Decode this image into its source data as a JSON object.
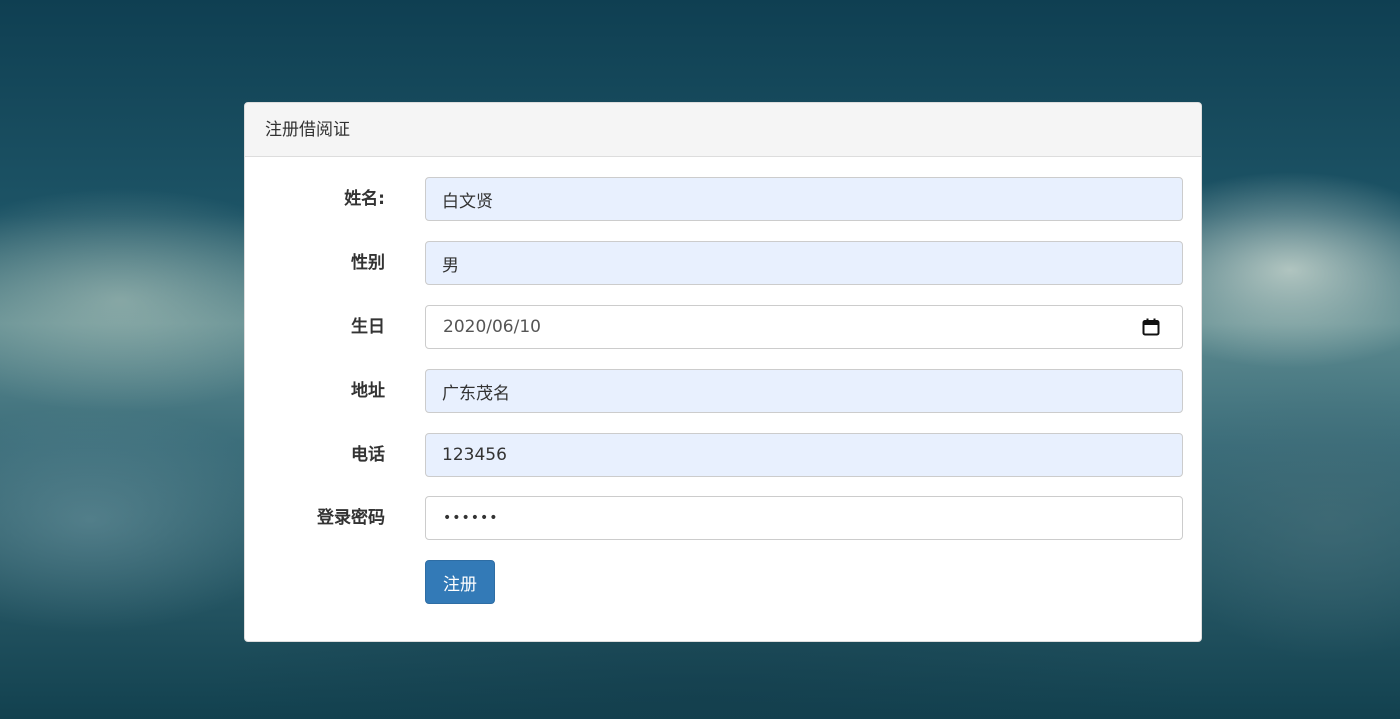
{
  "panel": {
    "title": "注册借阅证"
  },
  "form": {
    "name": {
      "label": "姓名:",
      "value": "白文贤"
    },
    "gender": {
      "label": "性别",
      "value": "男"
    },
    "birthday": {
      "label": "生日",
      "value": "2020/06/10"
    },
    "address": {
      "label": "地址",
      "value": "广东茂名"
    },
    "phone": {
      "label": "电话",
      "value": "123456"
    },
    "password": {
      "label": "登录密码",
      "masked": "••••••"
    },
    "submit_label": "注册"
  },
  "colors": {
    "primary_button": "#337ab7",
    "autofill_background": "#e8f0fe",
    "panel_heading_background": "#f5f5f5"
  },
  "icons": {
    "date_picker": "calendar-icon"
  }
}
